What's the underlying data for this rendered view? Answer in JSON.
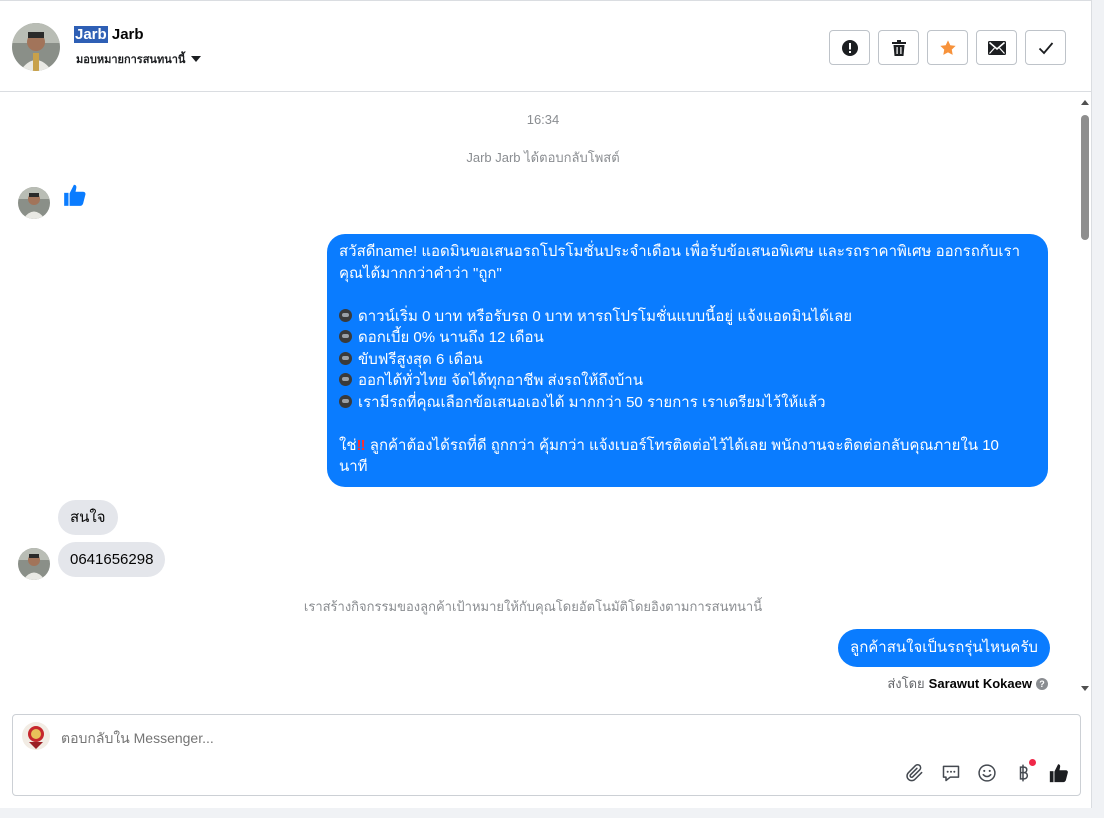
{
  "colors": {
    "accent": "#0a7cff",
    "star": "#f7923b",
    "incoming": "#e4e6eb"
  },
  "header": {
    "name_highlight": "Jarb",
    "name_rest": " Jarb",
    "assign_label": "มอบหมายการสนทนานี้",
    "actions": [
      "mark-spam-icon",
      "delete-icon",
      "star-icon",
      "mail-icon",
      "check-icon"
    ]
  },
  "thread": {
    "timestamp": "16:34",
    "system_reply": "Jarb Jarb ได้ตอบกลับโพสต์",
    "incoming_like": "thumbs-up-icon",
    "outgoing_big": {
      "line1": "สวัสดีname! แอดมินขอเสนอรถโปรโมชั่นประจำเดือน เพื่อรับข้อเสนอพิเศษ และรถราคาพิเศษ ออกรถกับเรา",
      "line2": "คุณได้มากกว่าคำว่า \"ถูก\"",
      "b1": "ดาวน์เริ่ม 0 บาท หรือรับรถ 0 บาท หารถโปรโมชั่นแบบนี้อยู่ แจ้งแอดมินได้เลย",
      "b2": "ดอกเบี้ย 0% นานถึง 12 เดือน",
      "b3": "ขับฟรีสูงสุด 6 เดือน",
      "b4": "ออกได้ทั่วไทย จัดได้ทุกอาชีพ ส่งรถให้ถึงบ้าน",
      "b5": "เรามีรถที่คุณเลือกข้อเสนอเองได้ มากกว่า 50 รายการ เราเตรียมไว้ให้แล้ว",
      "closing_prefix": "ใช่",
      "closing_mark": "‼",
      "closing_rest": " ลูกค้าต้องได้รถที่ดี ถูกกว่า คุ้มกว่า แจ้งเบอร์โทรติดต่อไว้ได้เลย พนักงานจะติดต่อกลับคุณภายใน 10",
      "closing_end": "นาที"
    },
    "incoming_1": "สนใจ",
    "incoming_2": "0641656298",
    "system_activity": "เราสร้างกิจกรรมของลูกค้าเป้าหมายให้กับคุณโดยอัตโนมัติโดยอิงตามการสนทนานี้",
    "outgoing_small": "ลูกค้าสนใจเป็นรถรุ่นไหนครับ",
    "sent_by_label": "ส่งโดย",
    "sent_by_name": "Sarawut Kokaew"
  },
  "composer": {
    "placeholder": "ตอบกลับใน Messenger...",
    "tools": [
      "attach-icon",
      "saved-replies-icon",
      "emoji-icon",
      "baht-payment-icon",
      "thumbs-up-icon"
    ]
  }
}
